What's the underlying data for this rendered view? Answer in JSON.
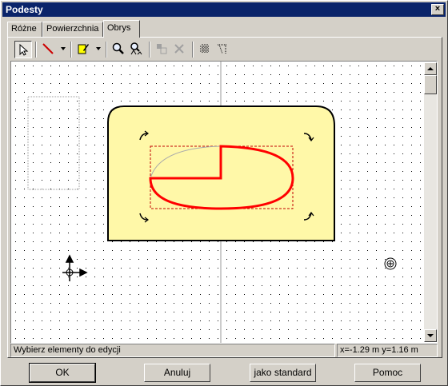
{
  "window": {
    "title": "Podesty",
    "close_label": "×"
  },
  "tabs": [
    {
      "label": "Różne"
    },
    {
      "label": "Powierzchnia"
    },
    {
      "label": "Obrys"
    }
  ],
  "toolbar": {
    "items": [
      {
        "name": "select-arrow-icon"
      },
      {
        "name": "line-tool-icon"
      },
      {
        "name": "edit-pencil-icon"
      },
      {
        "name": "zoom-icon"
      },
      {
        "name": "zoom-all-icon"
      },
      {
        "name": "layers-icon"
      },
      {
        "name": "delete-icon"
      },
      {
        "name": "grid-icon"
      },
      {
        "name": "snap-icon"
      }
    ]
  },
  "status": {
    "message": "Wybierz elementy do edycji",
    "coords": "x=-1.29 m  y=1.16 m"
  },
  "buttons": {
    "ok": "OK",
    "cancel": "Anuluj",
    "standard": "jako standard",
    "help": "Pomoc"
  },
  "colors": {
    "shape_fill": "#fff8a8",
    "outline_red": "#ff0000",
    "title_bar": "#0a246a"
  }
}
